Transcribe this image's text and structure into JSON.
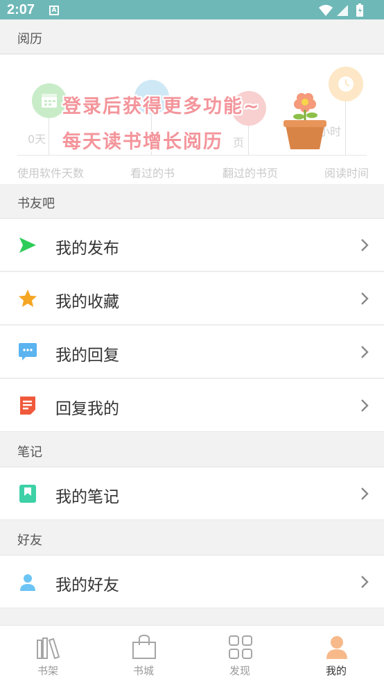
{
  "status_bar": {
    "time": "2:07",
    "notification_letter": "A"
  },
  "sections": {
    "history_title": "阅历",
    "bookclub_title": "书友吧",
    "notes_title": "笔记",
    "friends_title": "好友"
  },
  "history": {
    "promo_line1": "登录后获得更多功能~",
    "promo_line2": "每天读书增长阅历",
    "stat_days_value": "0天",
    "stat_pages_value": "页",
    "stat_hours_value": "小时",
    "labels": [
      "使用软件天数",
      "看过的书",
      "翻过的书页",
      "阅读时间"
    ],
    "colors": {
      "days": "#c8ecc8",
      "books": "#cfe8f6",
      "pages": "#f8d0d0",
      "time": "#fde7c6"
    }
  },
  "menu": {
    "my_posts": "我的发布",
    "my_favorites": "我的收藏",
    "my_replies": "我的回复",
    "replies_to_me": "回复我的",
    "my_notes": "我的笔记",
    "my_friends": "我的好友"
  },
  "icon_colors": {
    "posts": "#2ecc58",
    "favorites": "#f5a623",
    "replies": "#5bb3f0",
    "replies_to_me": "#f05a3c",
    "notes": "#3ed1a8",
    "friends": "#6cc4f4",
    "active_tab": "#f7b98a"
  },
  "tabs": [
    "书架",
    "书城",
    "发现",
    "我的"
  ],
  "active_tab": "我的"
}
